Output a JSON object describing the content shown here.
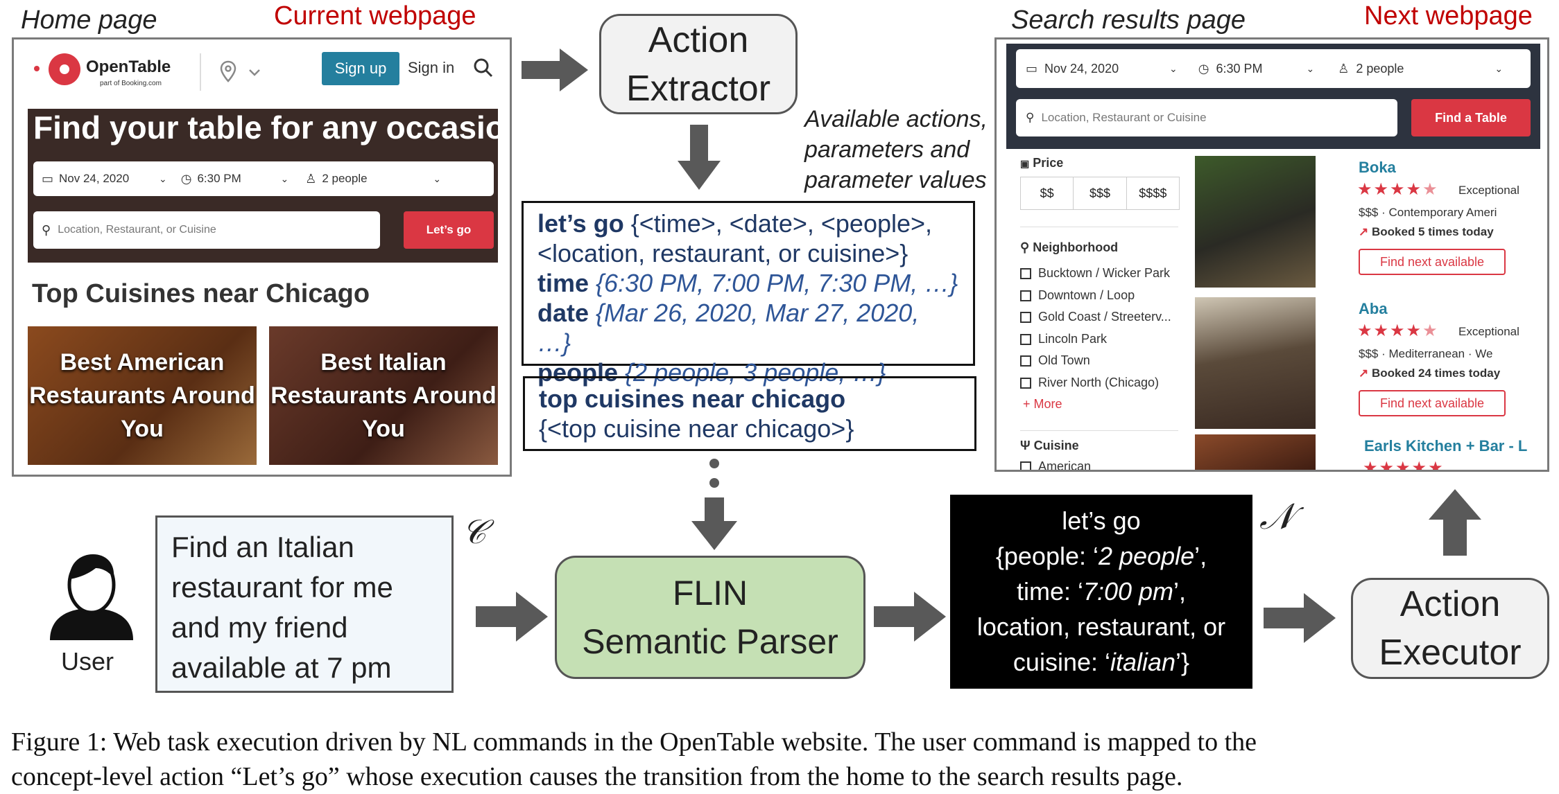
{
  "labels": {
    "home_page": "Home page",
    "current_webpage": "Current webpage",
    "search_results_page": "Search results page",
    "next_webpage": "Next webpage",
    "available_actions": [
      "Available actions,",
      "parameters and",
      "parameter values"
    ],
    "user": "User",
    "c_symbol": "𝒞",
    "n_symbol": "𝒩"
  },
  "boxes": {
    "action_extractor": [
      "Action",
      "Extractor"
    ],
    "flin": [
      "FLIN",
      "Semantic Parser"
    ],
    "action_executor": [
      "Action",
      "Executor"
    ]
  },
  "actions_box": {
    "line1_bold": "let’s go",
    "line1_rest": " {<time>, <date>, <people>,",
    "line2": "<location, restaurant, or cuisine>}",
    "time_bold": "time",
    "time_vals": " {6:30 PM, 7:00 PM, 7:30 PM, …}",
    "date_bold": "date",
    "date_vals": " {Mar 26, 2020, Mar 27, 2020, …}",
    "people_bold": "people",
    "people_vals": " {2 people, 3 people, …}"
  },
  "cuisine_box": {
    "title": "top cuisines near chicago",
    "param": "{<top cuisine near chicago>}"
  },
  "command": [
    "Find an Italian",
    "restaurant for me",
    "and my friend",
    "available at 7 pm"
  ],
  "output": {
    "l1": "let’s go",
    "l2a": "{people: ‘",
    "l2b": "2 people",
    "l2c": "’,",
    "l3a": "time:  ‘",
    "l3b": "7:00 pm",
    "l3c": "’,",
    "l4": "location, restaurant, or",
    "l5a": "cuisine: ‘",
    "l5b": "italian",
    "l5c": "’}"
  },
  "home": {
    "brand": "OpenTable",
    "brand_sub": "part of Booking.com",
    "signup": "Sign up",
    "signin": "Sign in",
    "hero_title": "Find your table for any occasion",
    "date": "Nov 24, 2020",
    "time": "6:30 PM",
    "people": "2 people",
    "search_placeholder": "Location, Restaurant, or Cuisine",
    "go": "Let’s go",
    "section_title": "Top Cuisines near Chicago",
    "cards": [
      "Best American Restaurants Around You",
      "Best Italian Restaurants Around You"
    ]
  },
  "results": {
    "date": "Nov 24, 2020",
    "time": "6:30 PM",
    "people": "2 people",
    "search_placeholder": "Location, Restaurant or Cuisine",
    "find": "Find a Table",
    "price_label": "Price",
    "prices": [
      "$$",
      "$$$",
      "$$$$"
    ],
    "neighborhood_label": "Neighborhood",
    "neighborhoods": [
      "Bucktown / Wicker Park",
      "Downtown / Loop",
      "Gold Coast / Streeterv...",
      "Lincoln Park",
      "Old Town",
      "River North (Chicago)"
    ],
    "more": "+ More",
    "cuisine_label": "Cuisine",
    "cuisine_first": "American",
    "restaurants": [
      {
        "name": "Boka",
        "rating_text": "Exceptional",
        "price": "$$$",
        "category": "Contemporary Ameri",
        "booked": "Booked 5 times today",
        "button": "Find next available",
        "stars": 4.5
      },
      {
        "name": "Aba",
        "rating_text": "Exceptional",
        "price": "$$$",
        "category": "Mediterranean",
        "extra": "We",
        "booked": "Booked 24 times today",
        "button": "Find next available",
        "stars": 4.5
      },
      {
        "name": "Earls Kitchen + Bar - L"
      }
    ]
  },
  "caption": {
    "line1": "Figure 1: Web task execution driven by NL commands in the OpenTable website.  The user command is mapped to the",
    "line2": "concept-level action “Let’s go” whose execution causes the transition from the home to the search results page."
  },
  "colors": {
    "accent_red": "#da3743",
    "label_red": "#c00000",
    "flin_green": "#c5e0b4",
    "command_bg": "#f2f7fb",
    "signup_teal": "#247f9e"
  }
}
